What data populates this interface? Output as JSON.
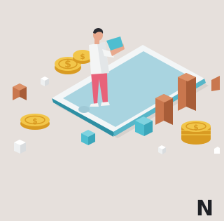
{
  "illustration": {
    "subject": "person-standing-on-smartphone",
    "icons": [
      "dollar-coin-icon",
      "coin-stack-icon",
      "bar-column-icon",
      "cube-icon"
    ]
  },
  "corner_text": "N",
  "colors": {
    "background": "#e6e0dc",
    "phone_body": "#f3f6f7",
    "phone_screen": "#a9d4e0",
    "phone_edge": "#3aa6ba",
    "coin_gold": "#f2c64a",
    "coin_shade": "#d99b22",
    "column_brown": "#c9774e",
    "cube_teal": "#4fbed0",
    "shirt": "#f4f5f5",
    "pants": "#e8627a"
  }
}
